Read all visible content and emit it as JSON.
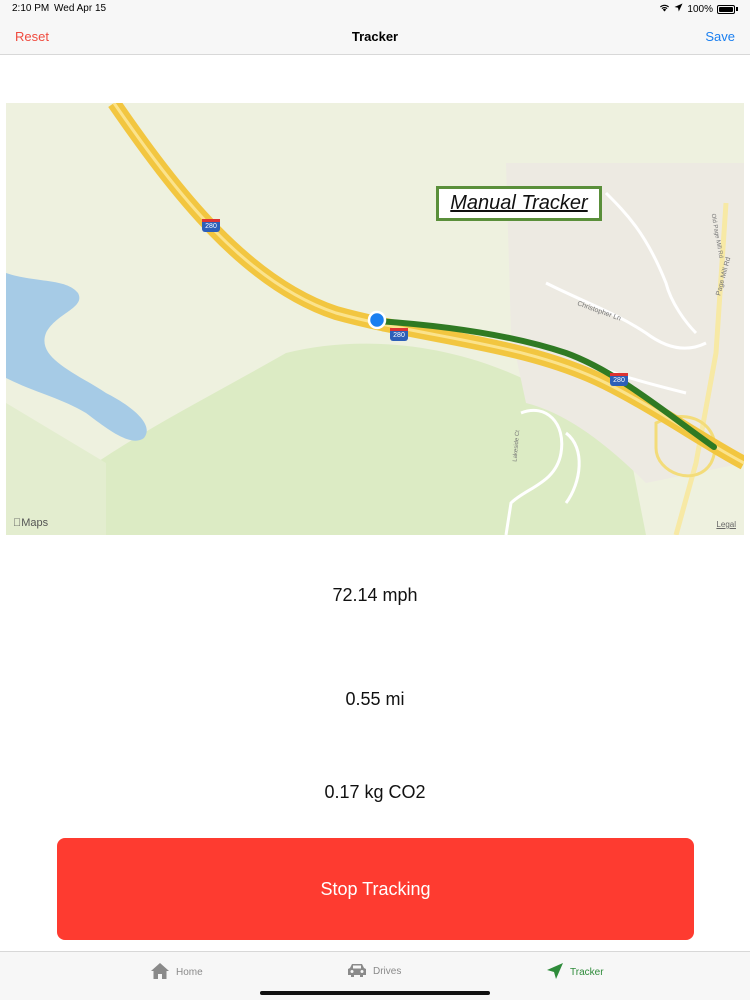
{
  "status_bar": {
    "time": "2:10 PM",
    "date": "Wed Apr 15",
    "battery": "100%"
  },
  "nav": {
    "left_label": "Reset",
    "title": "Tracker",
    "right_label": "Save"
  },
  "map": {
    "label": "Manual Tracker",
    "maps_logo": "Maps",
    "legal": "Legal",
    "highway_shield": "280",
    "roads": {
      "road1": "Christopher Ln",
      "road2": "Page Mill Rd",
      "road3": "Old Page Mill Rd",
      "road4": "Lakeside Ct"
    }
  },
  "stats": {
    "speed": "72.14 mph",
    "distance": "0.55 mi",
    "co2": "0.17 kg CO2"
  },
  "button": {
    "stop_label": "Stop Tracking"
  },
  "tabs": {
    "home": "Home",
    "drives": "Drives",
    "tracker": "Tracker"
  },
  "colors": {
    "accent_red": "#fe3b30",
    "reset_red": "#f04b3f",
    "save_blue": "#1a7ff0",
    "tracker_green": "#2e8b3a",
    "route_green": "#2f7a23",
    "label_border": "#5a8f3a"
  }
}
